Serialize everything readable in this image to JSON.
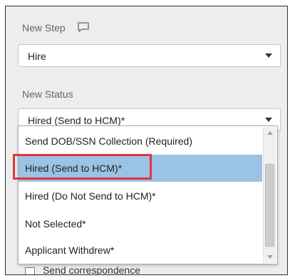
{
  "new_step": {
    "label": "New Step",
    "icon": "comment-icon",
    "selected": "Hire"
  },
  "new_status": {
    "label": "New Status",
    "selected": "Hired (Send to HCM)*",
    "options": [
      {
        "label": "Send DOB/SSN Collection (Required)"
      },
      {
        "label": "Hired (Send to HCM)*"
      },
      {
        "label": "Hired (Do Not Send to HCM)*"
      },
      {
        "label": "Not Selected*"
      },
      {
        "label": "Applicant Withdrew*"
      }
    ],
    "highlighted_index": 1
  },
  "send_correspondence": {
    "label": "Send correspondence",
    "checked": false
  },
  "colors": {
    "hover_option": "#9ac3e5",
    "annotation_box": "#e0353b",
    "panel_background": "#ededed"
  }
}
